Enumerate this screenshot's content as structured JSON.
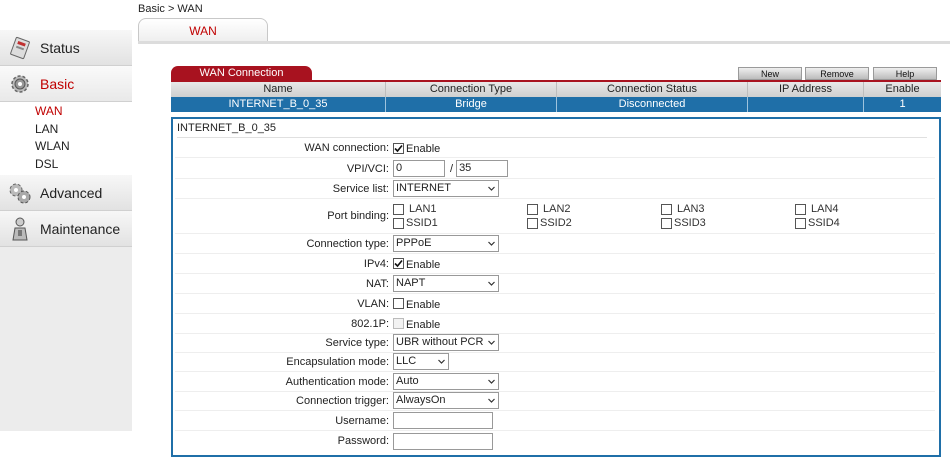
{
  "breadcrumb": "Basic > WAN",
  "tab_label": "WAN",
  "sidebar": {
    "items": [
      {
        "label": "Status",
        "icon": "status-icon"
      },
      {
        "label": "Basic",
        "icon": "basic-gear-icon",
        "active": true
      },
      {
        "label": "Advanced",
        "icon": "advanced-tools-icon"
      },
      {
        "label": "Maintenance",
        "icon": "maintenance-icon"
      }
    ],
    "sub": [
      "WAN",
      "LAN",
      "WLAN",
      "DSL"
    ]
  },
  "wan_connection_title": "WAN Connection",
  "buttons": {
    "new": "New",
    "remove": "Remove",
    "help": "Help"
  },
  "table": {
    "headers": [
      "Name",
      "Connection Type",
      "Connection Status",
      "IP Address",
      "Enable"
    ],
    "rows": [
      [
        "INTERNET_B_0_35",
        "Bridge",
        "Disconnected",
        "",
        "1"
      ]
    ]
  },
  "form": {
    "title": "INTERNET_B_0_35",
    "wan_connection_label": "WAN connection:",
    "enable_text": "Enable",
    "vpi_vci_label": "VPI/VCI:",
    "vpi": "0",
    "slash": "/",
    "vci": "35",
    "service_list_label": "Service list:",
    "service_list": "INTERNET",
    "port_binding_label": "Port binding:",
    "ports": [
      "LAN1",
      "LAN2",
      "LAN3",
      "LAN4",
      "SSID1",
      "SSID2",
      "SSID3",
      "SSID4"
    ],
    "connection_type_label": "Connection type:",
    "connection_type": "PPPoE",
    "ipv4_label": "IPv4:",
    "nat_label": "NAT:",
    "nat": "NAPT",
    "vlan_label": "VLAN:",
    "dot1p_label": "802.1P:",
    "service_type_label": "Service type:",
    "service_type": "UBR without PCR",
    "encapsulation_label": "Encapsulation mode:",
    "encapsulation": "LLC",
    "auth_label": "Authentication mode:",
    "auth": "Auto",
    "trigger_label": "Connection trigger:",
    "trigger": "AlwaysOn",
    "username_label": "Username:",
    "username": "",
    "password_label": "Password:",
    "password": ""
  },
  "colors": {
    "accent_red": "#a8121f",
    "selected_blue": "#1f6fa8",
    "active_text": "#c00000"
  }
}
